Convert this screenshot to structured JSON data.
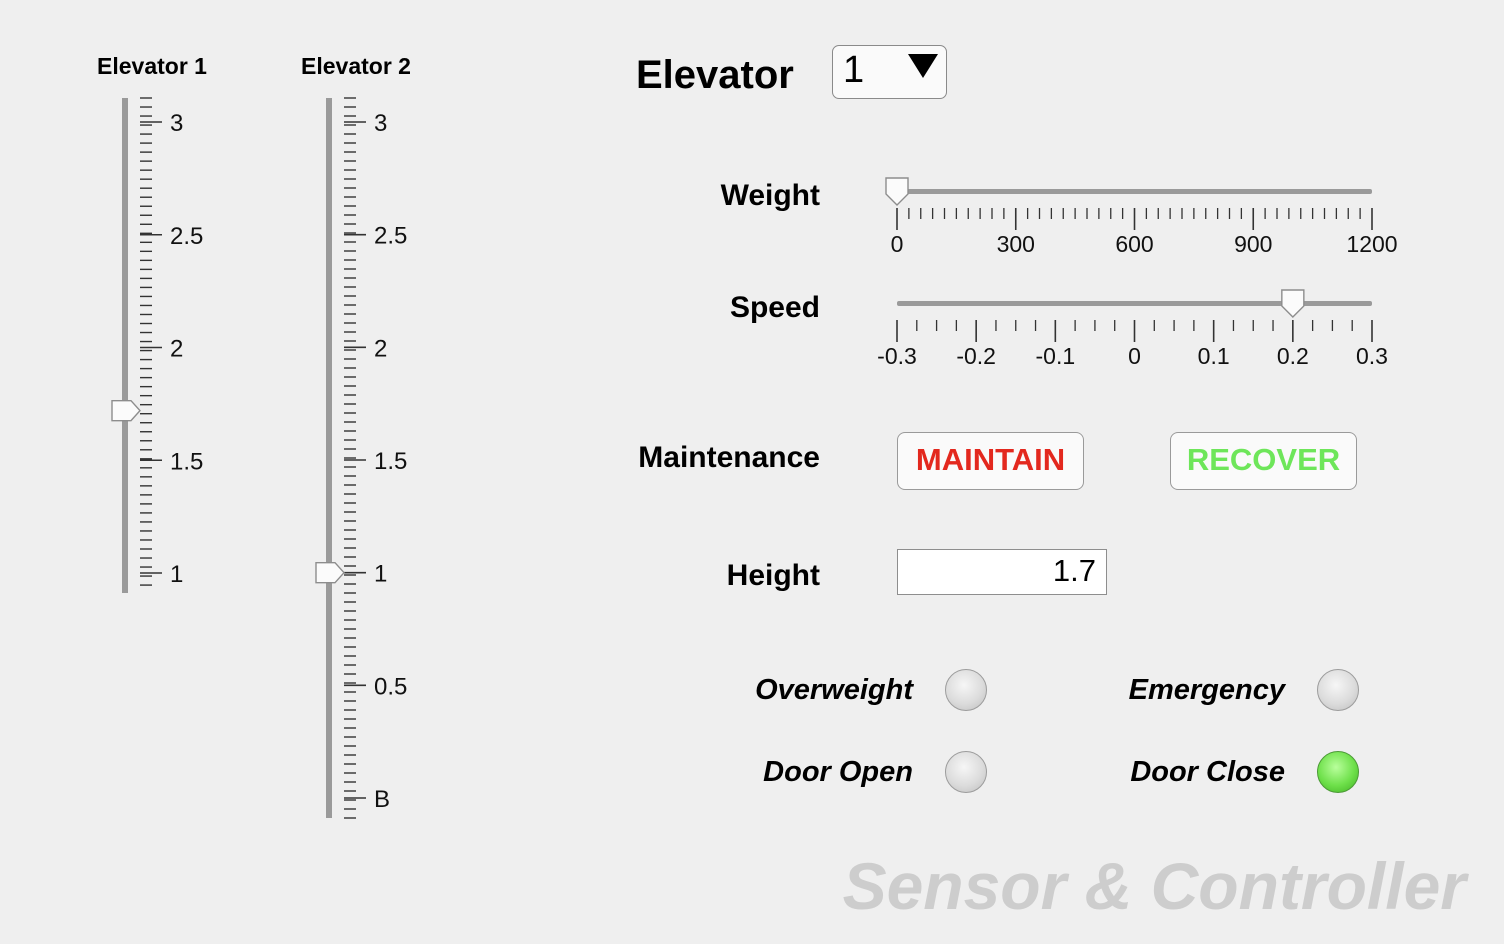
{
  "elevator1": {
    "label": "Elevator 1",
    "value": 1.72,
    "range": [
      1,
      3
    ],
    "ticks": [
      "3",
      "2.5",
      "2",
      "1.5",
      "1"
    ]
  },
  "elevator2": {
    "label": "Elevator 2",
    "value": 1,
    "range": [
      0,
      3
    ],
    "ticks": [
      "3",
      "2.5",
      "2",
      "1.5",
      "1",
      "0.5",
      "B"
    ]
  },
  "selector": {
    "label": "Elevator",
    "value": "1"
  },
  "weight": {
    "label": "Weight",
    "value": 0,
    "min": 0,
    "max": 1200,
    "ticks": [
      "0",
      "300",
      "600",
      "900",
      "1200"
    ]
  },
  "speed": {
    "label": "Speed",
    "value": 0.2,
    "min": -0.3,
    "max": 0.3,
    "ticks": [
      "-0.3",
      "-0.2",
      "-0.1",
      "0",
      "0.1",
      "0.2",
      "0.3"
    ]
  },
  "maintenance": {
    "label": "Maintenance",
    "maintain": "MAINTAIN",
    "recover": "RECOVER",
    "maintain_color": "#e3281e",
    "recover_color": "#6ee65a"
  },
  "height": {
    "label": "Height",
    "value": "1.7"
  },
  "indicators": {
    "overweight": {
      "label": "Overweight",
      "on": false
    },
    "emergency": {
      "label": "Emergency",
      "on": false
    },
    "door_open": {
      "label": "Door Open",
      "on": false
    },
    "door_close": {
      "label": "Door Close",
      "on": true
    }
  },
  "watermark": "Sensor & Controller"
}
